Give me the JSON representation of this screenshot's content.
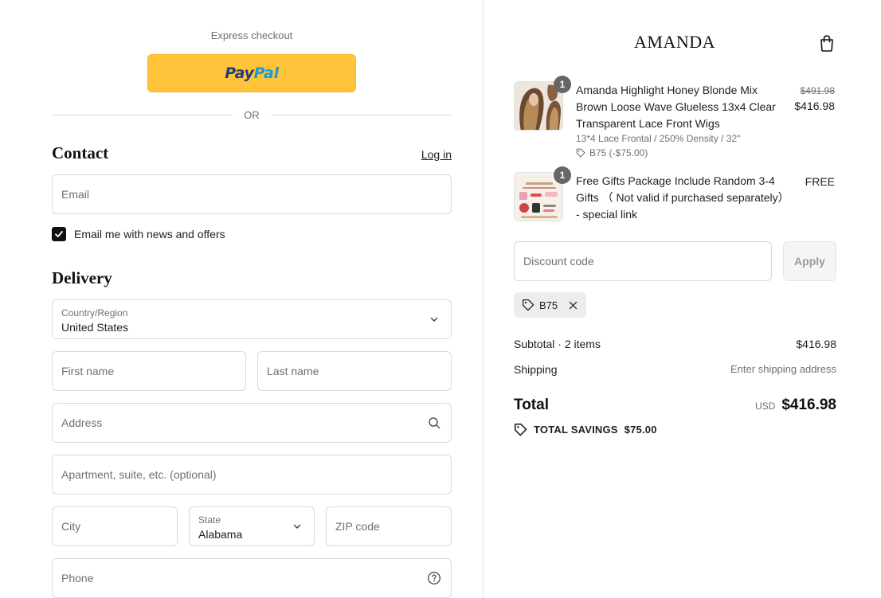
{
  "express": {
    "label": "Express checkout",
    "paypal_part1": "Pay",
    "paypal_part2": "Pal",
    "or_label": "OR"
  },
  "contact": {
    "heading": "Contact",
    "login_label": "Log in",
    "email_placeholder": "Email",
    "newsletter_label": "Email me with news and offers",
    "newsletter_checked": true
  },
  "delivery": {
    "heading": "Delivery",
    "country_label": "Country/Region",
    "country_value": "United States",
    "first_name_placeholder": "First name",
    "last_name_placeholder": "Last name",
    "address_placeholder": "Address",
    "apartment_placeholder": "Apartment, suite, etc. (optional)",
    "city_placeholder": "City",
    "state_label": "State",
    "state_value": "Alabama",
    "zip_placeholder": "ZIP code",
    "phone_placeholder": "Phone"
  },
  "store": {
    "brand": "AMANDA",
    "cart_icon": "shopping-bag-icon"
  },
  "cart": {
    "items": [
      {
        "quantity": "1",
        "title": "Amanda Highlight Honey Blonde Mix Brown Loose Wave Glueless 13x4 Clear Transparent Lace Front Wigs",
        "variant": "13*4 Lace Frontal / 250% Density / 32\"",
        "discount": "B75 (-$75.00)",
        "original_price": "$491.98",
        "price": "$416.98"
      },
      {
        "quantity": "1",
        "title": "Free Gifts Package Include Random 3-4 Gifts （ Not valid if purchased separately） - special link",
        "price": "FREE",
        "thumb_brand": "AMANDA",
        "thumb_caption": "FREE GIFT & PACKAGE"
      }
    ]
  },
  "discount": {
    "placeholder": "Discount code",
    "apply_label": "Apply",
    "applied_code": "B75"
  },
  "summary": {
    "subtotal_label": "Subtotal · 2 items",
    "subtotal_value": "$416.98",
    "shipping_label": "Shipping",
    "shipping_value": "Enter shipping address",
    "total_label": "Total",
    "currency": "USD",
    "total_value": "$416.98",
    "savings_label": "TOTAL SAVINGS",
    "savings_value": "$75.00"
  },
  "colors": {
    "paypal_yellow": "#ffc439",
    "paypal_dark_blue": "#253b80",
    "paypal_light_blue": "#179bd7",
    "checkbox": "#111111",
    "qty_badge": "#666666"
  }
}
